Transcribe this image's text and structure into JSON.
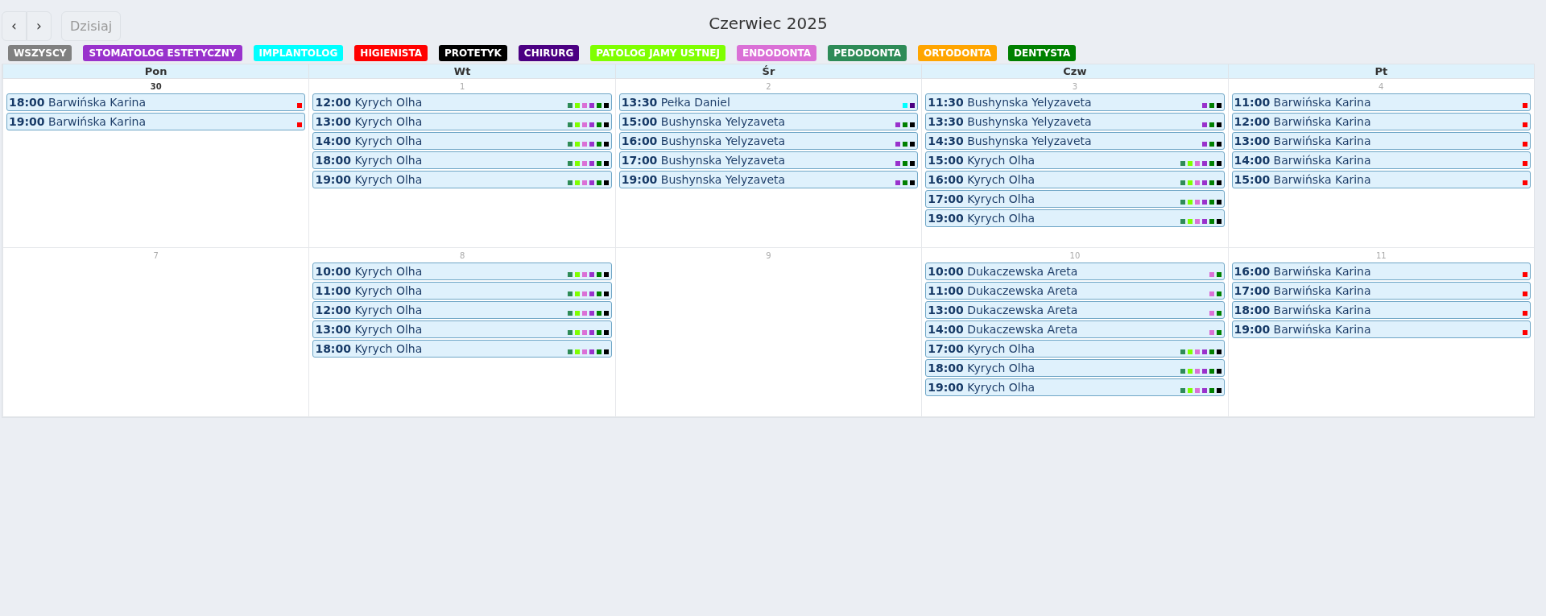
{
  "toolbar": {
    "prev": "‹",
    "next": "›",
    "today": {
      "label": "Dzisiaj",
      "disabled": true
    },
    "title": "Czerwiec 2025"
  },
  "legend": [
    {
      "label": "WSZYSCY",
      "color": "#808080"
    },
    {
      "label": "STOMATOLOG ESTETYCZNY",
      "color": "#9932cc"
    },
    {
      "label": "IMPLANTOLOG",
      "color": "#00ffff"
    },
    {
      "label": "HIGIENISTA",
      "color": "#ff0000"
    },
    {
      "label": "PROTETYK",
      "color": "#000000"
    },
    {
      "label": "CHIRURG",
      "color": "#4b0082"
    },
    {
      "label": "PATOLOG JAMY USTNEJ",
      "color": "#7fff00"
    },
    {
      "label": "ENDODONTA",
      "color": "#da70d6"
    },
    {
      "label": "PEDODONTA",
      "color": "#2e8b57"
    },
    {
      "label": "ORTODONTA",
      "color": "#ffa500"
    },
    {
      "label": "DENTYSTA",
      "color": "#008000"
    }
  ],
  "weekdays": [
    "Pon",
    "Wt",
    "Śr",
    "Czw",
    "Pt"
  ],
  "weeks": [
    {
      "days": [
        {
          "number": "30",
          "highlighted": true,
          "events": [
            {
              "time": "18:00",
              "name": "Barwińska Karina",
              "markers": [
                {
                  "color": "#ff0000"
                }
              ]
            },
            {
              "time": "19:00",
              "name": "Barwińska Karina",
              "markers": [
                {
                  "color": "#ff0000"
                }
              ]
            }
          ]
        },
        {
          "number": "1",
          "highlighted": false,
          "events": [
            {
              "time": "12:00",
              "name": "Kyrych Olha",
              "markers": [
                {
                  "color": "#2e8b57"
                },
                {
                  "color": "#7fff00"
                },
                {
                  "color": "#da70d6"
                },
                {
                  "color": "#9932cc"
                },
                {
                  "color": "#008000"
                },
                {
                  "color": "#000000"
                }
              ]
            },
            {
              "time": "13:00",
              "name": "Kyrych Olha",
              "markers": [
                {
                  "color": "#2e8b57"
                },
                {
                  "color": "#7fff00"
                },
                {
                  "color": "#da70d6"
                },
                {
                  "color": "#9932cc"
                },
                {
                  "color": "#008000"
                },
                {
                  "color": "#000000"
                }
              ]
            },
            {
              "time": "14:00",
              "name": "Kyrych Olha",
              "markers": [
                {
                  "color": "#2e8b57"
                },
                {
                  "color": "#7fff00"
                },
                {
                  "color": "#da70d6"
                },
                {
                  "color": "#9932cc"
                },
                {
                  "color": "#008000"
                },
                {
                  "color": "#000000"
                }
              ]
            },
            {
              "time": "18:00",
              "name": "Kyrych Olha",
              "markers": [
                {
                  "color": "#2e8b57"
                },
                {
                  "color": "#7fff00"
                },
                {
                  "color": "#da70d6"
                },
                {
                  "color": "#9932cc"
                },
                {
                  "color": "#008000"
                },
                {
                  "color": "#000000"
                }
              ]
            },
            {
              "time": "19:00",
              "name": "Kyrych Olha",
              "markers": [
                {
                  "color": "#2e8b57"
                },
                {
                  "color": "#7fff00"
                },
                {
                  "color": "#da70d6"
                },
                {
                  "color": "#9932cc"
                },
                {
                  "color": "#008000"
                },
                {
                  "color": "#000000"
                }
              ]
            }
          ]
        },
        {
          "number": "2",
          "highlighted": false,
          "events": [
            {
              "time": "13:30",
              "name": "Pełka Daniel",
              "markers": [
                {
                  "color": "#00ffff"
                },
                {
                  "color": "#4b0082"
                }
              ]
            },
            {
              "time": "15:00",
              "name": "Bushynska Yelyzaveta",
              "markers": [
                {
                  "color": "#9932cc"
                },
                {
                  "color": "#008000"
                },
                {
                  "color": "#000000"
                }
              ]
            },
            {
              "time": "16:00",
              "name": "Bushynska Yelyzaveta",
              "markers": [
                {
                  "color": "#9932cc"
                },
                {
                  "color": "#008000"
                },
                {
                  "color": "#000000"
                }
              ]
            },
            {
              "time": "17:00",
              "name": "Bushynska Yelyzaveta",
              "markers": [
                {
                  "color": "#9932cc"
                },
                {
                  "color": "#008000"
                },
                {
                  "color": "#000000"
                }
              ]
            },
            {
              "time": "19:00",
              "name": "Bushynska Yelyzaveta",
              "markers": [
                {
                  "color": "#9932cc"
                },
                {
                  "color": "#008000"
                },
                {
                  "color": "#000000"
                }
              ]
            }
          ]
        },
        {
          "number": "3",
          "highlighted": false,
          "events": [
            {
              "time": "11:30",
              "name": "Bushynska Yelyzaveta",
              "markers": [
                {
                  "color": "#9932cc"
                },
                {
                  "color": "#008000"
                },
                {
                  "color": "#000000"
                }
              ]
            },
            {
              "time": "13:30",
              "name": "Bushynska Yelyzaveta",
              "markers": [
                {
                  "color": "#9932cc"
                },
                {
                  "color": "#008000"
                },
                {
                  "color": "#000000"
                }
              ]
            },
            {
              "time": "14:30",
              "name": "Bushynska Yelyzaveta",
              "markers": [
                {
                  "color": "#9932cc"
                },
                {
                  "color": "#008000"
                },
                {
                  "color": "#000000"
                }
              ]
            },
            {
              "time": "15:00",
              "name": "Kyrych Olha",
              "markers": [
                {
                  "color": "#2e8b57"
                },
                {
                  "color": "#7fff00"
                },
                {
                  "color": "#da70d6"
                },
                {
                  "color": "#9932cc"
                },
                {
                  "color": "#008000"
                },
                {
                  "color": "#000000"
                }
              ]
            },
            {
              "time": "16:00",
              "name": "Kyrych Olha",
              "markers": [
                {
                  "color": "#2e8b57"
                },
                {
                  "color": "#7fff00"
                },
                {
                  "color": "#da70d6"
                },
                {
                  "color": "#9932cc"
                },
                {
                  "color": "#008000"
                },
                {
                  "color": "#000000"
                }
              ]
            },
            {
              "time": "17:00",
              "name": "Kyrych Olha",
              "markers": [
                {
                  "color": "#2e8b57"
                },
                {
                  "color": "#7fff00"
                },
                {
                  "color": "#da70d6"
                },
                {
                  "color": "#9932cc"
                },
                {
                  "color": "#008000"
                },
                {
                  "color": "#000000"
                }
              ]
            },
            {
              "time": "19:00",
              "name": "Kyrych Olha",
              "markers": [
                {
                  "color": "#2e8b57"
                },
                {
                  "color": "#7fff00"
                },
                {
                  "color": "#da70d6"
                },
                {
                  "color": "#9932cc"
                },
                {
                  "color": "#008000"
                },
                {
                  "color": "#000000"
                }
              ]
            }
          ]
        },
        {
          "number": "4",
          "highlighted": false,
          "events": [
            {
              "time": "11:00",
              "name": "Barwińska Karina",
              "markers": [
                {
                  "color": "#ff0000"
                }
              ]
            },
            {
              "time": "12:00",
              "name": "Barwińska Karina",
              "markers": [
                {
                  "color": "#ff0000"
                }
              ]
            },
            {
              "time": "13:00",
              "name": "Barwińska Karina",
              "markers": [
                {
                  "color": "#ff0000"
                }
              ]
            },
            {
              "time": "14:00",
              "name": "Barwińska Karina",
              "markers": [
                {
                  "color": "#ff0000"
                }
              ]
            },
            {
              "time": "15:00",
              "name": "Barwińska Karina",
              "markers": [
                {
                  "color": "#ff0000"
                }
              ]
            }
          ]
        }
      ]
    },
    {
      "days": [
        {
          "number": "7",
          "highlighted": false
        },
        {
          "number": "8",
          "highlighted": false,
          "events": [
            {
              "time": "10:00",
              "name": "Kyrych Olha",
              "markers": [
                {
                  "color": "#2e8b57"
                },
                {
                  "color": "#7fff00"
                },
                {
                  "color": "#da70d6"
                },
                {
                  "color": "#9932cc"
                },
                {
                  "color": "#008000"
                },
                {
                  "color": "#000000"
                }
              ]
            },
            {
              "time": "11:00",
              "name": "Kyrych Olha",
              "markers": [
                {
                  "color": "#2e8b57"
                },
                {
                  "color": "#7fff00"
                },
                {
                  "color": "#da70d6"
                },
                {
                  "color": "#9932cc"
                },
                {
                  "color": "#008000"
                },
                {
                  "color": "#000000"
                }
              ]
            },
            {
              "time": "12:00",
              "name": "Kyrych Olha",
              "markers": [
                {
                  "color": "#2e8b57"
                },
                {
                  "color": "#7fff00"
                },
                {
                  "color": "#da70d6"
                },
                {
                  "color": "#9932cc"
                },
                {
                  "color": "#008000"
                },
                {
                  "color": "#000000"
                }
              ]
            },
            {
              "time": "13:00",
              "name": "Kyrych Olha",
              "markers": [
                {
                  "color": "#2e8b57"
                },
                {
                  "color": "#7fff00"
                },
                {
                  "color": "#da70d6"
                },
                {
                  "color": "#9932cc"
                },
                {
                  "color": "#008000"
                },
                {
                  "color": "#000000"
                }
              ]
            },
            {
              "time": "18:00",
              "name": "Kyrych Olha",
              "markers": [
                {
                  "color": "#2e8b57"
                },
                {
                  "color": "#7fff00"
                },
                {
                  "color": "#da70d6"
                },
                {
                  "color": "#9932cc"
                },
                {
                  "color": "#008000"
                },
                {
                  "color": "#000000"
                }
              ]
            }
          ]
        },
        {
          "number": "9",
          "highlighted": false
        },
        {
          "number": "10",
          "highlighted": false,
          "events": [
            {
              "time": "10:00",
              "name": "Dukaczewska Areta",
              "markers": [
                {
                  "color": "#da70d6"
                },
                {
                  "color": "#008000"
                }
              ]
            },
            {
              "time": "11:00",
              "name": "Dukaczewska Areta",
              "markers": [
                {
                  "color": "#da70d6"
                },
                {
                  "color": "#008000"
                }
              ]
            },
            {
              "time": "13:00",
              "name": "Dukaczewska Areta",
              "markers": [
                {
                  "color": "#da70d6"
                },
                {
                  "color": "#008000"
                }
              ]
            },
            {
              "time": "14:00",
              "name": "Dukaczewska Areta",
              "markers": [
                {
                  "color": "#da70d6"
                },
                {
                  "color": "#008000"
                }
              ]
            },
            {
              "time": "17:00",
              "name": "Kyrych Olha",
              "markers": [
                {
                  "color": "#2e8b57"
                },
                {
                  "color": "#7fff00"
                },
                {
                  "color": "#da70d6"
                },
                {
                  "color": "#9932cc"
                },
                {
                  "color": "#008000"
                },
                {
                  "color": "#000000"
                }
              ]
            },
            {
              "time": "18:00",
              "name": "Kyrych Olha",
              "markers": [
                {
                  "color": "#2e8b57"
                },
                {
                  "color": "#7fff00"
                },
                {
                  "color": "#da70d6"
                },
                {
                  "color": "#9932cc"
                },
                {
                  "color": "#008000"
                },
                {
                  "color": "#000000"
                }
              ]
            },
            {
              "time": "19:00",
              "name": "Kyrych Olha",
              "markers": [
                {
                  "color": "#2e8b57"
                },
                {
                  "color": "#7fff00"
                },
                {
                  "color": "#da70d6"
                },
                {
                  "color": "#9932cc"
                },
                {
                  "color": "#008000"
                },
                {
                  "color": "#000000"
                }
              ]
            }
          ]
        },
        {
          "number": "11",
          "highlighted": false,
          "events": [
            {
              "time": "16:00",
              "name": "Barwińska Karina",
              "markers": [
                {
                  "color": "#ff0000"
                }
              ]
            },
            {
              "time": "17:00",
              "name": "Barwińska Karina",
              "markers": [
                {
                  "color": "#ff0000"
                }
              ]
            },
            {
              "time": "18:00",
              "name": "Barwińska Karina",
              "markers": [
                {
                  "color": "#ff0000"
                }
              ]
            },
            {
              "time": "19:00",
              "name": "Barwińska Karina",
              "markers": [
                {
                  "color": "#ff0000"
                }
              ]
            }
          ]
        }
      ]
    }
  ]
}
